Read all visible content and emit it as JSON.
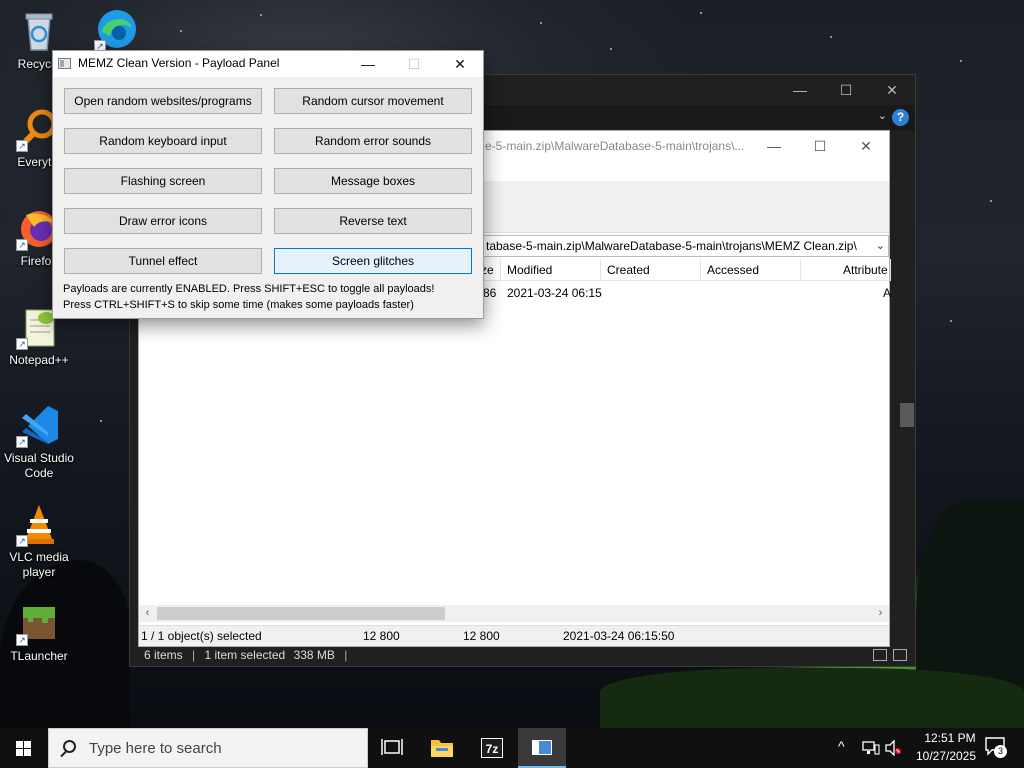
{
  "desktop": {
    "icons": [
      {
        "label": "Recycle",
        "icon": "recycle-bin-icon"
      },
      {
        "label": "",
        "icon": "edge-browser-icon"
      },
      {
        "label": "Everythi",
        "icon": "everything-search-icon"
      },
      {
        "label": "Firefox",
        "icon": "firefox-icon"
      },
      {
        "label": "Notepad++",
        "icon": "notepad-plus-plus-icon"
      },
      {
        "label": "Visual Studio Code",
        "icon": "vscode-icon"
      },
      {
        "label": "VLC media player",
        "icon": "vlc-icon"
      },
      {
        "label": "TLauncher",
        "icon": "tlauncher-icon"
      }
    ]
  },
  "explorer": {
    "status_items": "6 items",
    "status_selected": "1 item selected",
    "status_size": "338 MB",
    "status_sep": "|"
  },
  "sevenzip": {
    "title": "e-5-main.zip\\MalwareDatabase-5-main\\trojans\\...",
    "address": "tabase-5-main.zip\\MalwareDatabase-5-main\\trojans\\MEMZ Clean.zip\\",
    "columns": [
      "ze",
      "Modified",
      "Created",
      "Accessed",
      "Attribute"
    ],
    "row": {
      "size_tail": "86",
      "modified": "2021-03-24 06:15",
      "attr_tail": "A"
    },
    "status": {
      "selection": "1 / 1 object(s) selected",
      "size": "12 800",
      "packed": "12 800",
      "modified": "2021-03-24 06:15:50"
    }
  },
  "memz": {
    "title": "MEMZ Clean Version - Payload Panel",
    "buttons": [
      "Open random websites/programs",
      "Random cursor movement",
      "Random keyboard input",
      "Random error sounds",
      "Flashing screen",
      "Message boxes",
      "Draw error icons",
      "Reverse text",
      "Tunnel effect",
      "Screen glitches"
    ],
    "note1": "Payloads are currently ENABLED. Press SHIFT+ESC to toggle all payloads!",
    "note2": "Press CTRL+SHIFT+S to skip some time (makes some payloads faster)"
  },
  "taskbar": {
    "search_placeholder": "Type here to search",
    "time": "12:51 PM",
    "date": "10/27/2025",
    "notification_count": "3"
  },
  "colors": {
    "accent": "#0078d7",
    "taskbar": "#101010",
    "dialog": "#f0f0f0"
  }
}
